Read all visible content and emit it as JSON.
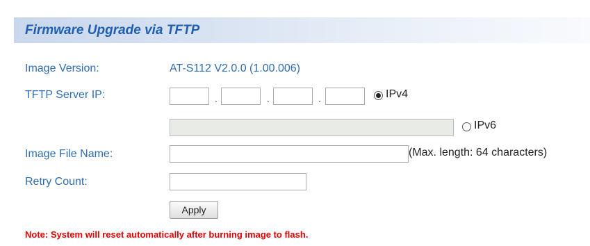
{
  "header": {
    "title": "Firmware Upgrade via TFTP"
  },
  "form": {
    "image_version_label": "Image Version:",
    "image_version_value": "AT-S112 V2.0.0 (1.00.006)",
    "tftp_server_ip_label": "TFTP Server IP:",
    "ipv4_octets": [
      "",
      "",
      "",
      ""
    ],
    "octet_separator": ".",
    "ipv4_option_label": "IPv4",
    "ipv4_selected": true,
    "ipv6_value": "",
    "ipv6_option_label": "IPv6",
    "ipv6_selected": false,
    "image_file_name_label": "Image File Name:",
    "image_file_name_value": "",
    "image_file_name_hint": "(Max. length: 64 characters)",
    "retry_count_label": "Retry Count:",
    "retry_count_value": "",
    "apply_label": "Apply"
  },
  "note": "Note: System will reset automatically after burning image to flash.",
  "colors": {
    "label": "#2e6db4",
    "title": "#1f5fae",
    "note": "#e00000"
  }
}
